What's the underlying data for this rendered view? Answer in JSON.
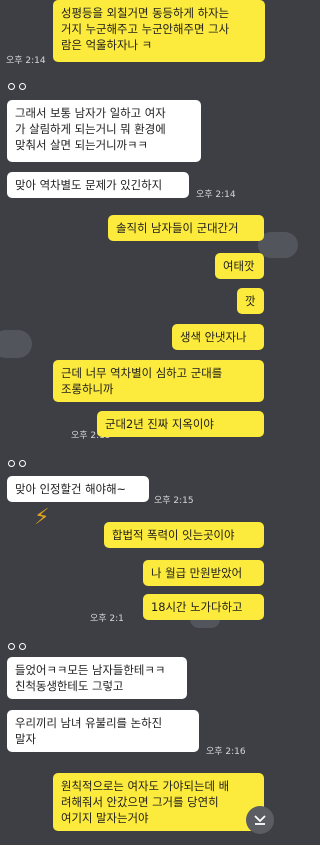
{
  "messages": [
    {
      "id": "m1",
      "side": "me",
      "text": "성평등을 외칠거면 동등하게 하자는\n거지 누군해주고 누군안해주면 그사\n람은 억울하자나 ㅋ"
    },
    {
      "id": "t1",
      "text": "오후 2:14"
    },
    {
      "id": "m2",
      "side": "other",
      "text": "그래서 보통 남자가 일하고 여자\n가 살림하게 되는거니 뭐 환경에\n맞춰서 살면 되는거니까ㅋㅋ"
    },
    {
      "id": "m3",
      "side": "other",
      "text": "맞아 역차별도 문제가 있긴하지"
    },
    {
      "id": "t2",
      "text": "오후 2:14"
    },
    {
      "id": "m4",
      "side": "me",
      "text": "솔직히 남자들이 군대간거"
    },
    {
      "id": "m5",
      "side": "me",
      "text": "여태깟"
    },
    {
      "id": "m6",
      "side": "me",
      "text": "깟"
    },
    {
      "id": "m7",
      "side": "me",
      "text": "생색 안냇자나"
    },
    {
      "id": "m8",
      "side": "me",
      "text": "근데 너무 역차별이 심하고 군대를\n조롱하니까"
    },
    {
      "id": "t3",
      "text": "오후 2:15"
    },
    {
      "id": "m9",
      "side": "me",
      "text": "군대2년 진짜 지옥이야"
    },
    {
      "id": "m10",
      "side": "other",
      "text": "맞아 인정할건 해야해~"
    },
    {
      "id": "t4",
      "text": "오후 2:15"
    },
    {
      "id": "m11",
      "side": "me",
      "text": "합법적 폭력이 잇는곳이야"
    },
    {
      "id": "m12",
      "side": "me",
      "text": "나 월급 만원받았어"
    },
    {
      "id": "t5",
      "text": "오후 2:1"
    },
    {
      "id": "m13",
      "side": "me",
      "text": "18시간 노가다하고"
    },
    {
      "id": "m14",
      "side": "other",
      "text": "들었어ㅋㅋ모든 남자들한테ㅋㅋ\n친척동생한테도 그렇고"
    },
    {
      "id": "m15",
      "side": "other",
      "text": "우리끼리 남녀 유불리를 논하진\n말자"
    },
    {
      "id": "t6",
      "text": "오후 2:16"
    },
    {
      "id": "m16",
      "side": "me",
      "text": "원칙적으로는 여자도 가야되는데 배\n려해줘서 안갔으면 그거를 당연히\n여기지 말자는거야"
    }
  ],
  "icons": {
    "avatar": "avatar-dots-icon",
    "scroll": "chevron-down-double-icon"
  },
  "colors": {
    "background": "#3d3f45",
    "my_bubble": "#fcea3c",
    "other_bubble": "#ffffff"
  }
}
